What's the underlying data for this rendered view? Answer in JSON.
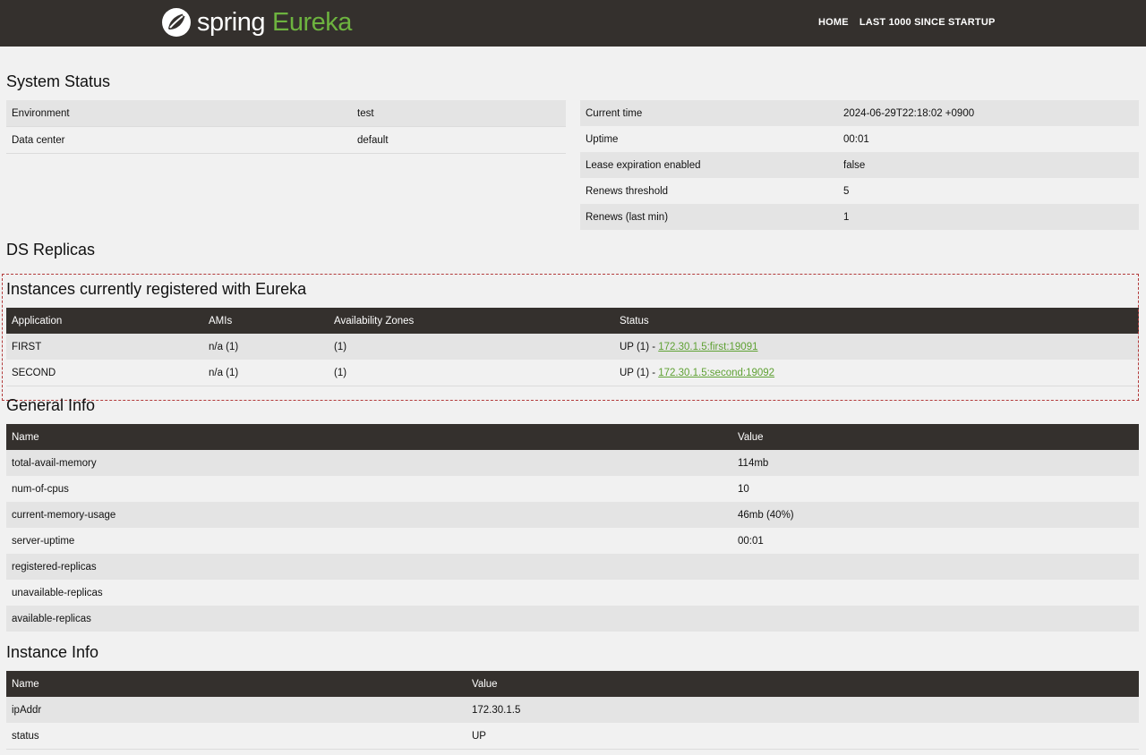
{
  "nav": {
    "brand_spring": "spring",
    "brand_eureka": "Eureka",
    "links": [
      "HOME",
      "LAST 1000 SINCE STARTUP"
    ]
  },
  "system_status": {
    "title": "System Status",
    "left": [
      {
        "label": "Environment",
        "value": "test"
      },
      {
        "label": "Data center",
        "value": "default"
      }
    ],
    "right": [
      {
        "label": "Current time",
        "value": "2024-06-29T22:18:02 +0900"
      },
      {
        "label": "Uptime",
        "value": "00:01"
      },
      {
        "label": "Lease expiration enabled",
        "value": "false"
      },
      {
        "label": "Renews threshold",
        "value": "5"
      },
      {
        "label": "Renews (last min)",
        "value": "1"
      }
    ]
  },
  "ds_replicas": {
    "title": "DS Replicas"
  },
  "instances": {
    "title": "Instances currently registered with Eureka",
    "headers": [
      "Application",
      "AMIs",
      "Availability Zones",
      "Status"
    ],
    "rows": [
      {
        "application": "FIRST",
        "amis": "n/a (1)",
        "zones": "(1)",
        "status_prefix": "UP (1) - ",
        "instance": "172.30.1.5:first:19091"
      },
      {
        "application": "SECOND",
        "amis": "n/a (1)",
        "zones": "(1)",
        "status_prefix": "UP (1) - ",
        "instance": "172.30.1.5:second:19092"
      }
    ]
  },
  "general_info": {
    "title": "General Info",
    "headers": [
      "Name",
      "Value"
    ],
    "rows": [
      {
        "name": "total-avail-memory",
        "value": "114mb"
      },
      {
        "name": "num-of-cpus",
        "value": "10"
      },
      {
        "name": "current-memory-usage",
        "value": "46mb (40%)"
      },
      {
        "name": "server-uptime",
        "value": "00:01"
      },
      {
        "name": "registered-replicas",
        "value": ""
      },
      {
        "name": "unavailable-replicas",
        "value": ""
      },
      {
        "name": "available-replicas",
        "value": ""
      }
    ]
  },
  "instance_info": {
    "title": "Instance Info",
    "headers": [
      "Name",
      "Value"
    ],
    "rows": [
      {
        "name": "ipAddr",
        "value": "172.30.1.5"
      },
      {
        "name": "status",
        "value": "UP"
      }
    ]
  },
  "colors": {
    "navbar": "#34302d",
    "accent": "#6db33f",
    "link": "#5fa134"
  }
}
